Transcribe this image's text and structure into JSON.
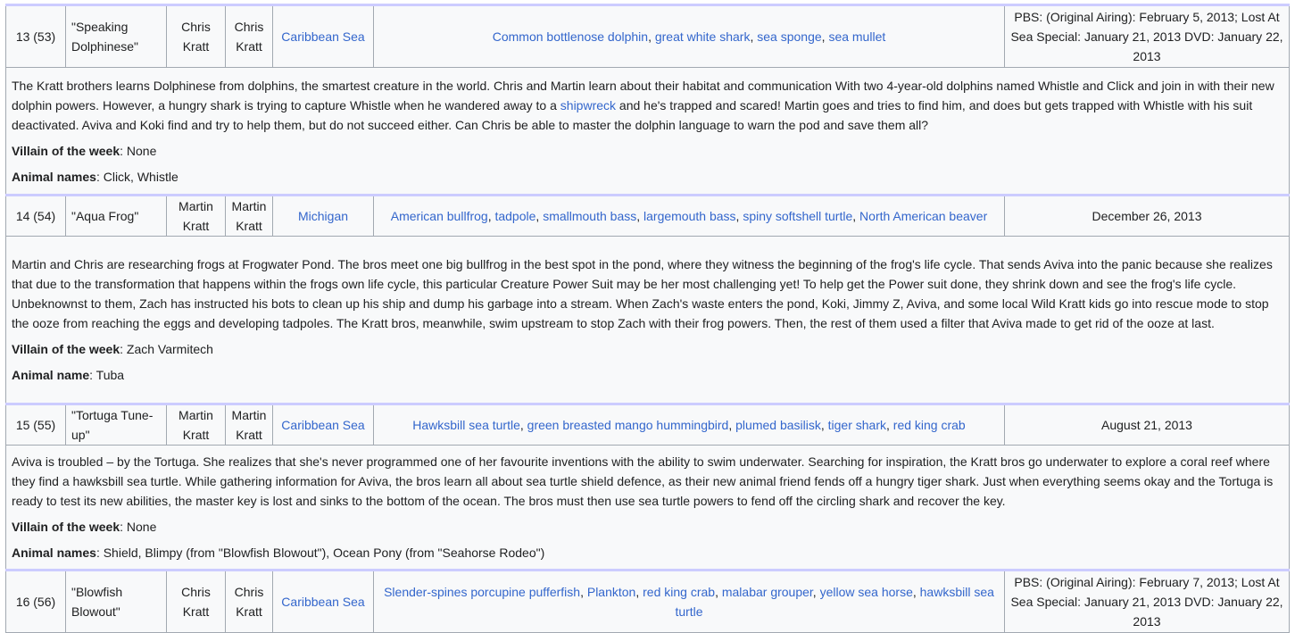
{
  "episodes": [
    {
      "number": "13 (53)",
      "title": "\"Speaking Dolphinese\"",
      "directed_by": "Chris Kratt",
      "written_by": "Chris Kratt",
      "location": "Caribbean Sea",
      "animals": [
        "Common bottlenose dolphin",
        "great white shark",
        "sea sponge",
        "sea mullet"
      ],
      "air_date": "PBS: (Original Airing): February 5, 2013; Lost At Sea Special: January 21, 2013 DVD: January 22, 2013",
      "description_before": "The Kratt brothers learns Dolphinese from dolphins, the smartest creature in the world. Chris and Martin learn about their habitat and communication With two 4-year-old dolphins named Whistle and Click and join in with their new dolphin powers. However, a hungry shark is trying to capture Whistle when he wandered away to a ",
      "description_link": "shipwreck",
      "description_after": " and he's trapped and scared! Martin goes and tries to find him, and does but gets trapped with Whistle with his suit deactivated. Aviva and Koki find and try to help them, but do not succeed either. Can Chris be able to master the dolphin language to warn the pod and save them all?",
      "villain_label": "Villain of the week",
      "villain": ": None",
      "names_label": "Animal names",
      "names": ": Click, Whistle"
    },
    {
      "number": "14 (54)",
      "title": "\"Aqua Frog\"",
      "directed_by": "Martin Kratt",
      "written_by": "Martin Kratt",
      "location": "Michigan",
      "animals": [
        "American bullfrog",
        "tadpole",
        "smallmouth bass",
        "largemouth bass",
        "spiny softshell turtle",
        "North American beaver"
      ],
      "air_date": "December 26, 2013",
      "description_before": "Martin and Chris are researching frogs at Frogwater Pond. The bros meet one big bullfrog in the best spot in the pond, where they witness the beginning of the frog's life cycle. That sends Aviva into the panic because she realizes that due to the transformation that happens within the frogs own life cycle, this particular Creature Power Suit may be her most challenging yet! To help get the Power suit done, they shrink down and see the frog's life cycle. Unbeknownst to them, Zach has instructed his bots to clean up his ship and dump his garbage into a stream. When Zach's waste enters the pond, Koki, Jimmy Z, Aviva, and some local Wild Kratt kids go into rescue mode to stop the ooze from reaching the eggs and developing tadpoles. The Kratt bros, meanwhile, swim upstream to stop Zach with their frog powers. Then, the rest of them used a filter that Aviva made to get rid of the ooze at last.",
      "description_link": "",
      "description_after": "",
      "villain_label": "Villain of the week",
      "villain": ": Zach Varmitech",
      "names_label": "Animal name",
      "names": ": Tuba"
    },
    {
      "number": "15 (55)",
      "title": "\"Tortuga Tune-up\"",
      "directed_by": "Martin Kratt",
      "written_by": "Martin Kratt",
      "location": "Caribbean Sea",
      "animals": [
        "Hawksbill sea turtle",
        "green breasted mango hummingbird",
        "plumed basilisk",
        "tiger shark",
        "red king crab"
      ],
      "air_date": "August 21, 2013",
      "description_before": "Aviva is troubled – by the Tortuga. She realizes that she's never programmed one of her favourite inventions with the ability to swim underwater. Searching for inspiration, the Kratt bros go underwater to explore a coral reef where they find a hawksbill sea turtle. While gathering information for Aviva, the bros learn all about sea turtle shield defence, as their new animal friend fends off a hungry tiger shark. Just when everything seems okay and the Tortuga is ready to test its new abilities, the master key is lost and sinks to the bottom of the ocean. The bros must then use sea turtle powers to fend off the circling shark and recover the key.",
      "description_link": "",
      "description_after": "",
      "villain_label": "Villain of the week",
      "villain": ": None",
      "names_label": "Animal names",
      "names": ": Shield, Blimpy (from \"Blowfish Blowout\"), Ocean Pony (from \"Seahorse Rodeo\")"
    },
    {
      "number": "16 (56)",
      "title": "\"Blowfish Blowout\"",
      "directed_by": "Chris Kratt",
      "written_by": "Chris Kratt",
      "location": "Caribbean Sea",
      "animals": [
        "Slender-spines porcupine pufferfish",
        "Plankton",
        "red king crab",
        "malabar grouper",
        "yellow sea horse",
        "hawksbill sea turtle"
      ],
      "air_date": "PBS: (Original Airing): February 7, 2013; Lost At Sea Special: January 21, 2013 DVD: January 22, 2013"
    }
  ],
  "colors": {
    "link": "#3366cc",
    "border": "#a2a9b1",
    "row_separator": "#ccccff",
    "cell_bg": "#f8f9fa",
    "text": "#202122"
  }
}
